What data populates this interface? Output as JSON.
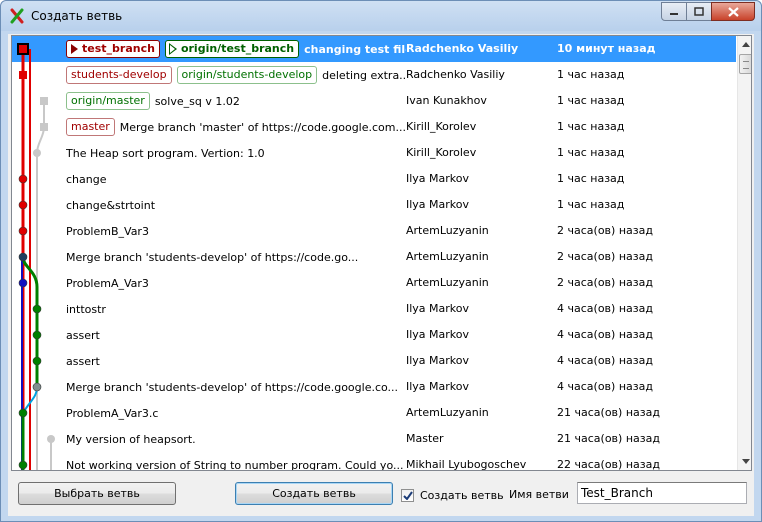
{
  "window": {
    "title": "Создать ветвь",
    "app_icon": "git-branch-icon",
    "controls": [
      "minimize-icon",
      "maximize-icon",
      "close-icon"
    ]
  },
  "commits": [
    {
      "refs": [
        {
          "type": "local",
          "label": "test_branch"
        },
        {
          "type": "remote",
          "label": "origin/test_branch"
        }
      ],
      "message": "changing test file ...",
      "author": "Radchenko Vasiliy",
      "date": "10 минут назад",
      "selected": true
    },
    {
      "refs": [
        {
          "type": "local",
          "label": "students-develop"
        },
        {
          "type": "remote",
          "label": "origin/students-develop"
        }
      ],
      "message": "deleting extra...",
      "author": "Radchenko Vasiliy",
      "date": "1 час назад"
    },
    {
      "refs": [
        {
          "type": "remote",
          "label": "origin/master"
        }
      ],
      "message": "solve_sq  v 1.02",
      "author": "Ivan Kunakhov",
      "date": "1 час назад"
    },
    {
      "refs": [
        {
          "type": "local",
          "label": "master"
        }
      ],
      "message": "Merge branch 'master' of https://code.google.com...",
      "author": "Kirill_Korolev",
      "date": "1 час назад"
    },
    {
      "refs": [],
      "message": "The Heap sort program. Vertion: 1.0",
      "author": "Kirill_Korolev",
      "date": "1 час назад"
    },
    {
      "refs": [],
      "message": "change",
      "author": "Ilya Markov",
      "date": "1 час назад"
    },
    {
      "refs": [],
      "message": "change&strtoint",
      "author": "Ilya Markov",
      "date": "1 час назад"
    },
    {
      "refs": [],
      "message": "ProblemB_Var3",
      "author": "ArtemLuzyanin",
      "date": "2 часа(ов) назад"
    },
    {
      "refs": [],
      "message": "Merge branch 'students-develop' of https://code.go...",
      "author": "ArtemLuzyanin",
      "date": "2 часа(ов) назад"
    },
    {
      "refs": [],
      "message": "ProblemA_Var3",
      "author": "ArtemLuzyanin",
      "date": "2 часа(ов) назад"
    },
    {
      "refs": [],
      "message": "inttostr",
      "author": "Ilya Markov",
      "date": "4 часа(ов) назад"
    },
    {
      "refs": [],
      "message": "assert",
      "author": "Ilya Markov",
      "date": "4 часа(ов) назад"
    },
    {
      "refs": [],
      "message": "assert",
      "author": "Ilya Markov",
      "date": "4 часа(ов) назад"
    },
    {
      "refs": [],
      "message": "Merge branch 'students-develop' of https://code.google.co...",
      "author": "Ilya Markov",
      "date": "4 часа(ов) назад"
    },
    {
      "refs": [],
      "message": "ProblemA_Var3.c",
      "author": "ArtemLuzyanin",
      "date": "21 часа(ов) назад"
    },
    {
      "refs": [],
      "message": "My version of heapsort.",
      "author": "Master",
      "date": "21 часа(ов) назад"
    },
    {
      "refs": [],
      "message": "Not working version of String to number program. Could yo...",
      "author": "Mikhail Lyubogoschev",
      "date": "22 часа(ов) назад"
    }
  ],
  "footer": {
    "select_branch_button": "Выбрать ветвь",
    "create_branch_button": "Создать ветвь",
    "checkbox_label": "Создать ветвь",
    "checkbox_checked": true,
    "name_label": "Имя ветви",
    "name_value": "Test_Branch"
  },
  "colors": {
    "selection": "#3399ff",
    "branch_red": "#e00000",
    "branch_green": "#008000",
    "branch_blue": "#1010c0",
    "branch_gray": "#c8c8c8"
  }
}
